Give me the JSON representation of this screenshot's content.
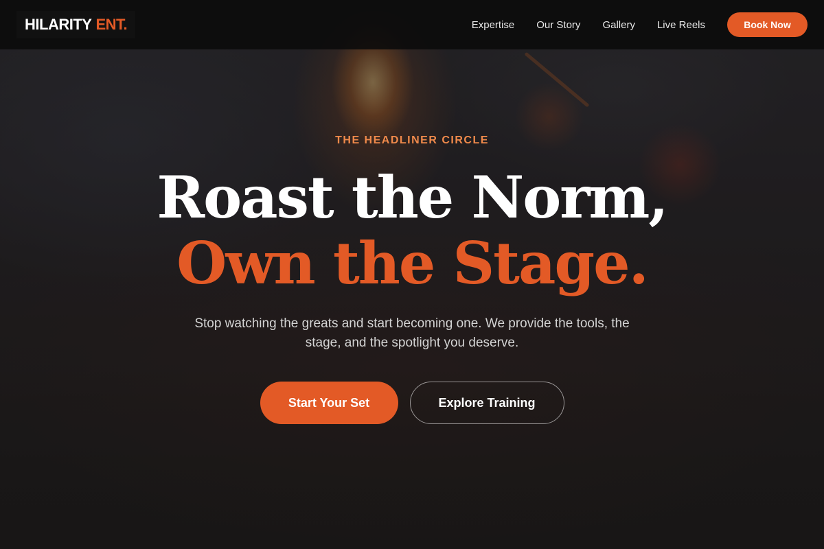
{
  "brand": {
    "name_main": "HILARITY",
    "name_accent": "ENT.",
    "accent_color": "#e35a26"
  },
  "nav": {
    "links": [
      "Expertise",
      "Our Story",
      "Gallery",
      "Live Reels"
    ],
    "cta_label": "Book Now"
  },
  "hero": {
    "eyebrow": "THE HEADLINER CIRCLE",
    "headline_line1": "Roast the Norm,",
    "headline_line2": "Own the Stage.",
    "subtext": "Stop watching the greats and start becoming one. We provide the tools, the stage, and the spotlight you deserve.",
    "primary_cta": "Start Your Set",
    "secondary_cta": "Explore Training"
  }
}
